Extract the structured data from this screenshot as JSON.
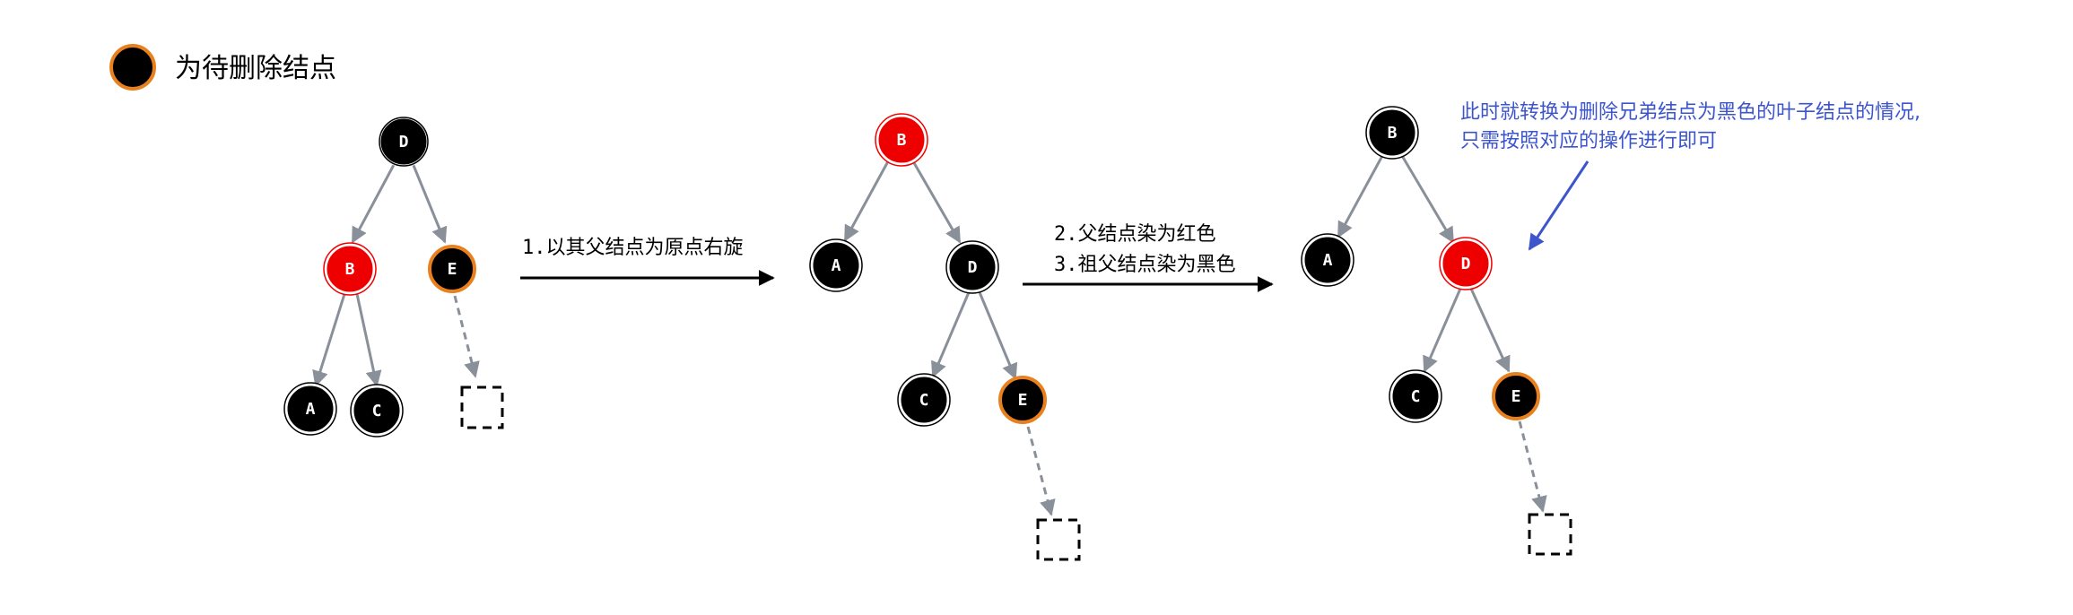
{
  "legend": {
    "text": "为待删除结点"
  },
  "steps": {
    "step1": "1.以其父结点为原点右旋",
    "step2_line1": "2.父结点染为红色",
    "step2_line2": "3.祖父结点染为黑色"
  },
  "note": {
    "line1": "此时就转换为删除兄弟结点为黑色的叶子结点的情况,",
    "line2": "只需按照对应的操作进行即可"
  },
  "trees": [
    {
      "name": "tree-initial",
      "nodes": [
        {
          "id": "D",
          "label": "D",
          "color": "black"
        },
        {
          "id": "B",
          "label": "B",
          "color": "red"
        },
        {
          "id": "E",
          "label": "E",
          "color": "black",
          "to_delete": true
        },
        {
          "id": "A",
          "label": "A",
          "color": "black"
        },
        {
          "id": "C",
          "label": "C",
          "color": "black"
        }
      ]
    },
    {
      "name": "tree-after-rotate",
      "nodes": [
        {
          "id": "B",
          "label": "B",
          "color": "red"
        },
        {
          "id": "A",
          "label": "A",
          "color": "black"
        },
        {
          "id": "D",
          "label": "D",
          "color": "black"
        },
        {
          "id": "C",
          "label": "C",
          "color": "black"
        },
        {
          "id": "E",
          "label": "E",
          "color": "black",
          "to_delete": true
        }
      ]
    },
    {
      "name": "tree-after-recolor",
      "nodes": [
        {
          "id": "B",
          "label": "B",
          "color": "black"
        },
        {
          "id": "A",
          "label": "A",
          "color": "black"
        },
        {
          "id": "D",
          "label": "D",
          "color": "red"
        },
        {
          "id": "C",
          "label": "C",
          "color": "black"
        },
        {
          "id": "E",
          "label": "E",
          "color": "black",
          "to_delete": true
        }
      ]
    }
  ],
  "colors": {
    "black_node": "#000000",
    "red_node": "#ee0000",
    "delete_ring": "#e8801e",
    "edge": "#8a9099",
    "arrow": "#000000",
    "note": "#3d55cc"
  }
}
